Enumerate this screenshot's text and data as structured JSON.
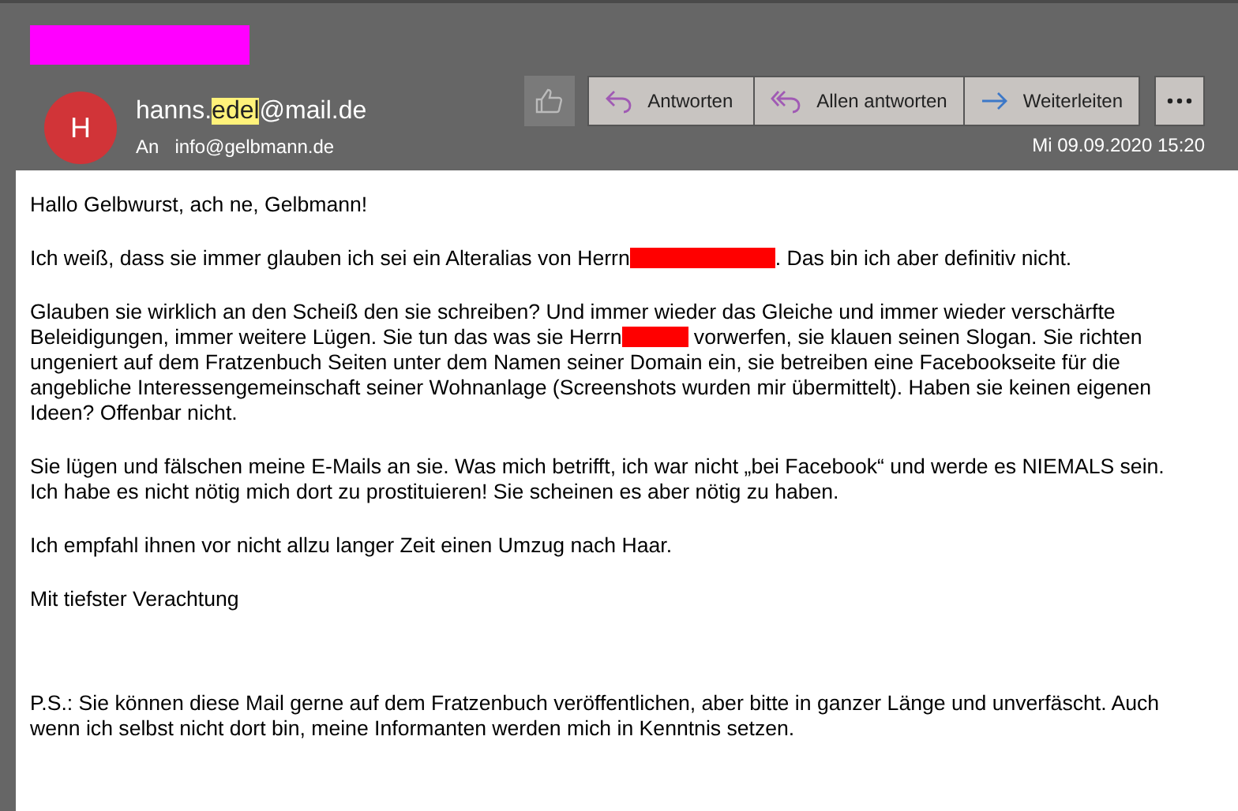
{
  "header": {
    "subject_redacted": true,
    "avatar": {
      "initial": "H",
      "color": "#d13438"
    },
    "sender": [
      {
        "text": "hanns.",
        "highlighted": false
      },
      {
        "text": "edel",
        "highlighted": true
      },
      {
        "text": "@mail.de",
        "highlighted": false
      }
    ],
    "to_label": "An",
    "to": "info@gelbmann.de",
    "date": "Mi 09.09.2020 15:20",
    "actions": [
      {
        "kind": "like"
      },
      {
        "kind": "reply",
        "label": "Antworten"
      },
      {
        "kind": "reply_all",
        "label": "Allen antworten"
      },
      {
        "kind": "forward",
        "label": "Weiterleiten"
      },
      {
        "kind": "more"
      }
    ]
  },
  "body": [
    {
      "lines": [
        [
          {
            "kind": "text",
            "text": "Hallo Gelbwurst, ach ne, Gelbmann!"
          }
        ]
      ]
    },
    {
      "lines": [
        [
          {
            "kind": "text",
            "text": "Ich weiß, dass sie immer glauben ich sei ein Alteralias von Herrn"
          },
          {
            "kind": "redaction_long"
          },
          {
            "kind": "text",
            "text": ". Das bin ich aber definitiv nicht."
          }
        ]
      ]
    },
    {
      "lines": [
        [
          {
            "kind": "text",
            "text": "Glauben sie wirklich an den Scheiß den sie schreiben? Und immer wieder das Gleiche und immer wieder verschärfte"
          }
        ],
        [
          {
            "kind": "text",
            "text": "Beleidigungen, immer weitere Lügen. Sie tun das was sie Herrn"
          },
          {
            "kind": "redaction_short"
          },
          {
            "kind": "text",
            "text": " vorwerfen, sie klauen seinen Slogan. Sie richten"
          }
        ],
        [
          {
            "kind": "text",
            "text": "ungeniert auf dem Fratzenbuch Seiten unter dem Namen seiner Domain ein, sie betreiben eine Facebookseite für die"
          }
        ],
        [
          {
            "kind": "text",
            "text": "angebliche Interessengemeinschaft seiner Wohnanlage (Screenshots wurden mir übermittelt). Haben sie keinen eigenen"
          }
        ],
        [
          {
            "kind": "text",
            "text": "Ideen? Offenbar nicht."
          }
        ]
      ]
    },
    {
      "lines": [
        [
          {
            "kind": "text",
            "text": "Sie lügen und fälschen meine E-Mails an sie. Was mich betrifft, ich war nicht „bei Facebook“ und werde es NIEMALS sein."
          }
        ],
        [
          {
            "kind": "text",
            "text": "Ich habe es nicht nötig mich dort zu prostituieren! Sie scheinen es aber nötig zu haben."
          }
        ]
      ]
    },
    {
      "lines": [
        [
          {
            "kind": "text",
            "text": "Ich empfahl ihnen vor nicht allzu langer Zeit einen Umzug nach Haar."
          }
        ]
      ]
    },
    {
      "lines": [
        [
          {
            "kind": "text",
            "text": "Mit tiefster Verachtung"
          }
        ]
      ]
    },
    {
      "lines": [
        [
          {
            "kind": "text",
            "text": "P.S.: Sie können diese Mail gerne auf dem Fratzenbuch veröffentlichen, aber bitte in ganzer Länge und unverfäscht. Auch"
          }
        ],
        [
          {
            "kind": "text",
            "text": "wenn ich selbst nicht dort bin, meine Informanten werden mich in Kenntnis setzen."
          }
        ]
      ]
    }
  ]
}
